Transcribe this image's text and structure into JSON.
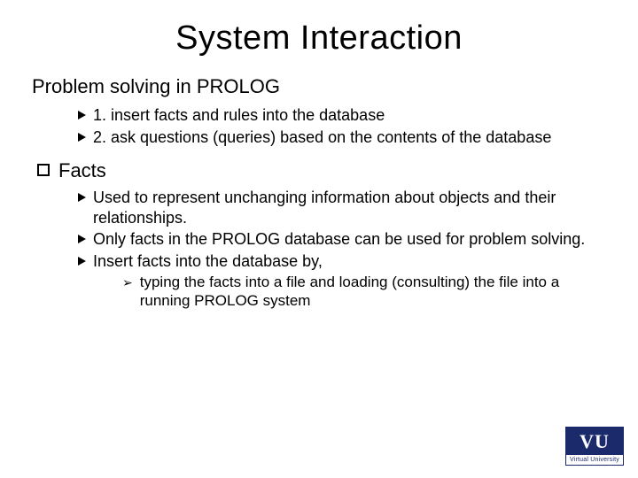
{
  "title": "System Interaction",
  "section1": {
    "heading": "Problem solving in PROLOG",
    "bullets": [
      "1. insert facts and rules into the database",
      "2. ask questions (queries) based on the contents of the database"
    ]
  },
  "section2": {
    "heading": "Facts",
    "bullets": [
      "Used to represent unchanging information about objects and their relationships.",
      "Only facts in the PROLOG database can be used for problem solving.",
      "Insert facts into the database by,"
    ],
    "subbullets": [
      "typing the facts into a file and loading (consulting) the file into a running PROLOG system"
    ]
  },
  "logo": {
    "main": "VU",
    "sub": "Virtual University"
  }
}
